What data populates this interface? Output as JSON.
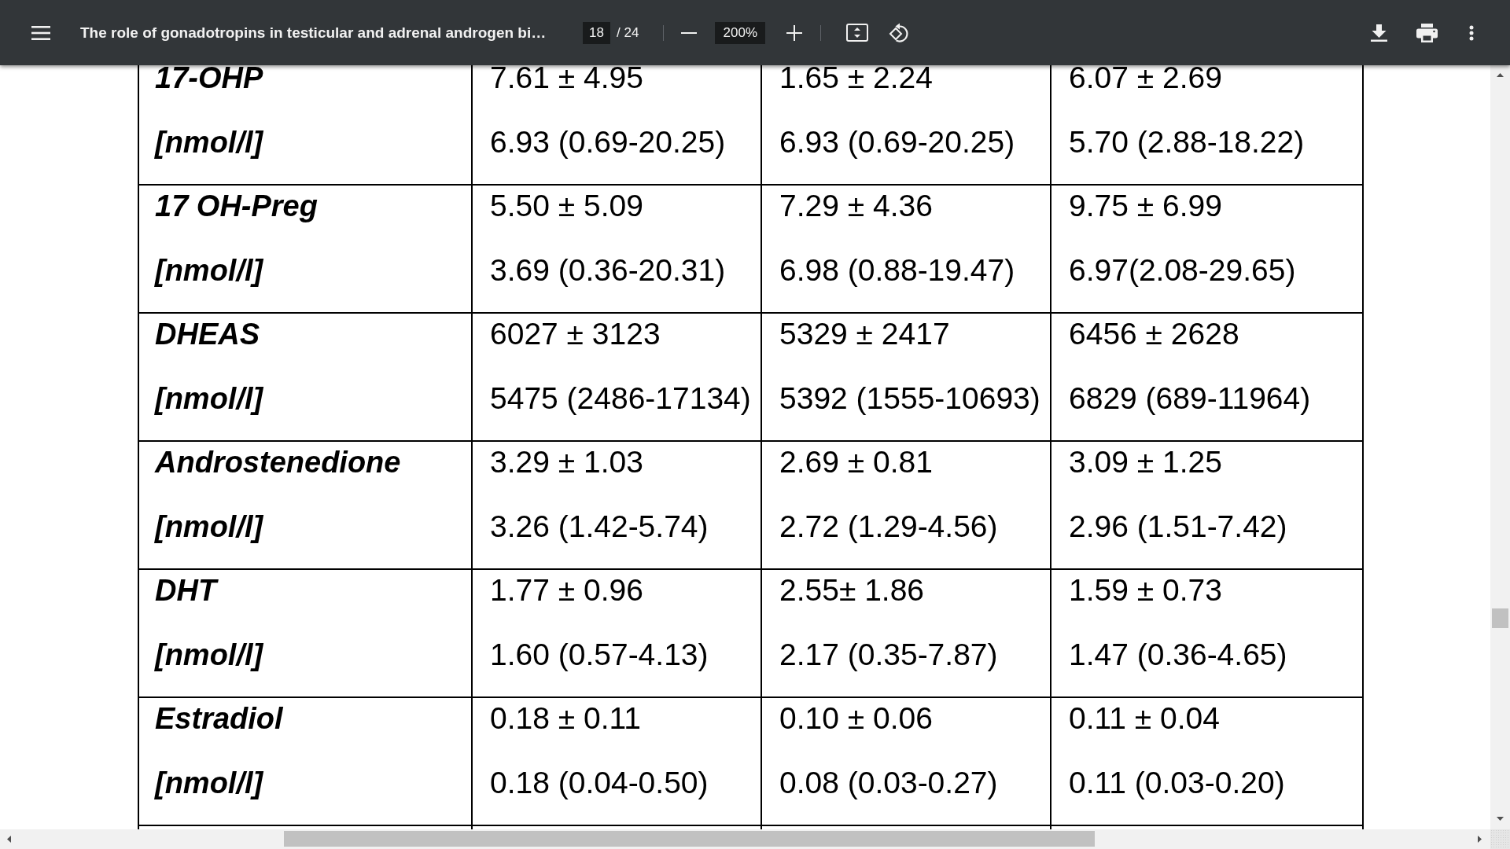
{
  "toolbar": {
    "title": "The role of gonadotropins in testicular and adrenal androgen bi…",
    "page": "18",
    "page_total": "/ 24",
    "zoom": "200%"
  },
  "table": {
    "rows": [
      {
        "name": "17-OHP",
        "unit": "[nmol/l]",
        "cells": [
          {
            "mean": "7.61 ± 4.95",
            "median": "6.93 (0.69-20.25)"
          },
          {
            "mean": "1.65 ± 2.24",
            "median": "6.93 (0.69-20.25)"
          },
          {
            "mean": "6.07 ± 2.69",
            "median": "5.70 (2.88-18.22)"
          }
        ]
      },
      {
        "name": "17 OH-Preg",
        "unit": "[nmol/l]",
        "cells": [
          {
            "mean": "5.50 ± 5.09",
            "median": "3.69 (0.36-20.31)"
          },
          {
            "mean": "7.29 ± 4.36",
            "median": "6.98 (0.88-19.47)"
          },
          {
            "mean": "9.75 ± 6.99",
            "median": "6.97(2.08-29.65)"
          }
        ]
      },
      {
        "name": "DHEAS",
        "unit": "[nmol/l]",
        "cells": [
          {
            "mean": "6027 ± 3123",
            "median": "5475 (2486-17134)"
          },
          {
            "mean": "5329 ± 2417",
            "median": "5392 (1555-10693)"
          },
          {
            "mean": "6456 ± 2628",
            "median": "6829 (689-11964)"
          }
        ]
      },
      {
        "name": "Androstenedione",
        "unit": "[nmol/l]",
        "cells": [
          {
            "mean": "3.29 ± 1.03",
            "median": "3.26 (1.42-5.74)"
          },
          {
            "mean": "2.69 ± 0.81",
            "median": "2.72 (1.29-4.56)"
          },
          {
            "mean": "3.09 ± 1.25",
            "median": "2.96 (1.51-7.42)"
          }
        ]
      },
      {
        "name": "DHT",
        "unit": "[nmol/l]",
        "cells": [
          {
            "mean": "1.77 ± 0.96",
            "median": "1.60 (0.57-4.13)"
          },
          {
            "mean": "2.55± 1.86",
            "median": "2.17 (0.35-7.87)"
          },
          {
            "mean": "1.59 ± 0.73",
            "median": "1.47 (0.36-4.65)"
          }
        ]
      },
      {
        "name": "Estradiol",
        "unit": "[nmol/l]",
        "cells": [
          {
            "mean": "0.18 ± 0.11",
            "median": "0.18 (0.04-0.50)"
          },
          {
            "mean": "0.10 ± 0.06",
            "median": "0.08 (0.03-0.27)"
          },
          {
            "mean": "0.11 ± 0.04",
            "median": "0.11 (0.03-0.20)"
          }
        ]
      }
    ]
  }
}
